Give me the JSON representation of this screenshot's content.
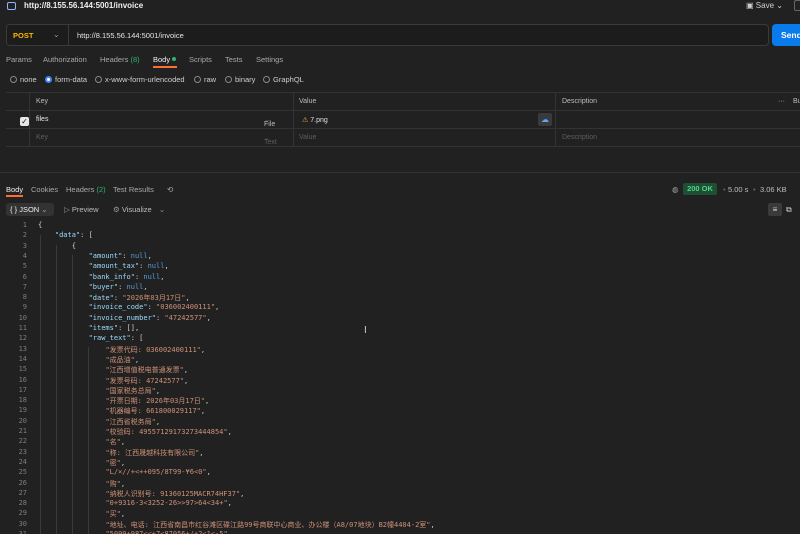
{
  "titlebar": {
    "url": "http://8.155.56.144:5001/invoice",
    "save_label": "Save"
  },
  "request": {
    "method": "POST",
    "url": "http://8.155.56.144:5001/invoice",
    "send_label": "Send"
  },
  "req_tabs": [
    {
      "label": "Params"
    },
    {
      "label": "Authorization"
    },
    {
      "label": "Headers",
      "count": "(8)"
    },
    {
      "label": "Body"
    },
    {
      "label": "Scripts"
    },
    {
      "label": "Tests"
    },
    {
      "label": "Settings"
    }
  ],
  "body_types": [
    "none",
    "form-data",
    "x-www-form-urlencoded",
    "raw",
    "binary",
    "GraphQL"
  ],
  "params_table": {
    "headers": {
      "key": "Key",
      "value": "Value",
      "description": "Description",
      "bulk": "Bu"
    },
    "row": {
      "key": "files",
      "type": "File",
      "value": "7.png"
    },
    "placeholder": {
      "key": "Key",
      "type": "Text",
      "value": "Value",
      "description": "Description"
    }
  },
  "resp_tabs": [
    {
      "label": "Body"
    },
    {
      "label": "Cookies"
    },
    {
      "label": "Headers",
      "count": "(2)"
    },
    {
      "label": "Test Results"
    }
  ],
  "response_meta": {
    "status": "200 OK",
    "time": "5.00 s",
    "size": "3.06 KB"
  },
  "view": {
    "format": "JSON",
    "preview": "Preview",
    "visualize": "Visualize"
  },
  "code_lines": [
    "{",
    "    \"data\": [",
    "        {",
    "            \"amount\": null,",
    "            \"amount_tax\": null,",
    "            \"bank_info\": null,",
    "            \"buyer\": null,",
    "            \"date\": \"2026年03月17日\",",
    "            \"invoice_code\": \"036002400111\",",
    "            \"invoice_number\": \"47242577\",",
    "            \"items\": [],",
    "            \"raw_text\": [",
    "                \"发票代码: 036002400111\",",
    "                \"成品油\",",
    "                \"江西增值税电普通发票\",",
    "                \"发票号码: 47242577\",",
    "                \"国家税务总局\",",
    "                \"开票日期: 2026年03月17日\",",
    "                \"机器编号: 661800029117\",",
    "                \"江西省税务局\",",
    "                \"校验码: 49557129173273444854\",",
    "                \"名\",",
    "                \"称: 江西晟越科技有限公司\",",
    "                \"密\",",
    "                \"L/×//+<++095/8T99-¥6<0\",",
    "                \"购\",",
    "                \"纳税人识别号: 91360125MACR74HF37\",",
    "                \"0+9316-3<3252-26>>97>64<34+\",",
    "                \"买\",",
    "                \"地址、电话: 江西省南昌市红谷滩区碟江路99号商联中心商业、办公楼（A8/07地块）B2幢4404-2室\",",
    "                \"5099+987<<+7<87056+/+2<1<-5\","
  ]
}
